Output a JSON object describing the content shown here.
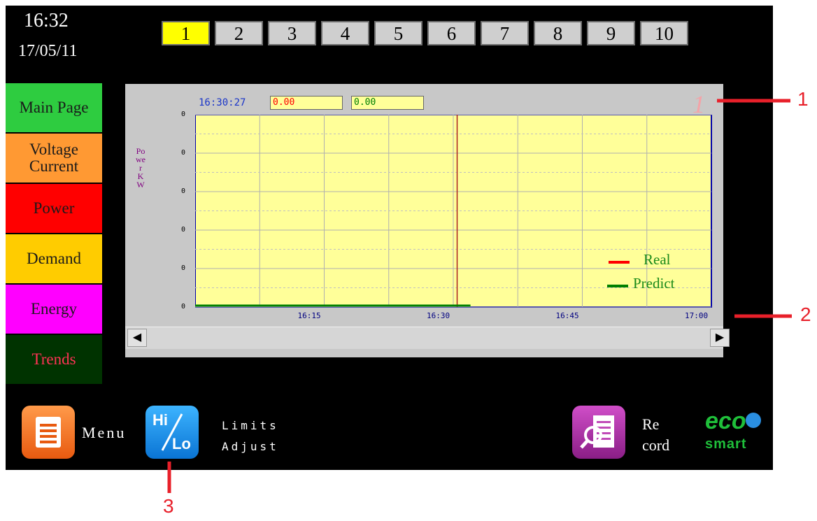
{
  "header": {
    "time": "16:32",
    "date": "17/05/11"
  },
  "tabs": [
    {
      "label": "1",
      "active": true
    },
    {
      "label": "2"
    },
    {
      "label": "3"
    },
    {
      "label": "4"
    },
    {
      "label": "5"
    },
    {
      "label": "6"
    },
    {
      "label": "7"
    },
    {
      "label": "8"
    },
    {
      "label": "9"
    },
    {
      "label": "10"
    }
  ],
  "nav": [
    {
      "label": "Main Page",
      "bg": "#2ecc40",
      "fg": "#1a1a1a"
    },
    {
      "label": "Voltage Current",
      "bg": "#ff9933",
      "fg": "#1a1a1a"
    },
    {
      "label": "Power",
      "bg": "#ff0000",
      "fg": "#1a1a1a"
    },
    {
      "label": "Demand",
      "bg": "#ffcc00",
      "fg": "#1a1a1a"
    },
    {
      "label": "Energy",
      "bg": "#ff00ff",
      "fg": "#1a1a1a"
    },
    {
      "label": "Trends",
      "bg": "#003300",
      "fg": "#ff3355"
    }
  ],
  "trend": {
    "cursor_time": "16:30:27",
    "real_value": "0.00",
    "predict_value": "0.00",
    "y_axis_label": "Power KW",
    "cursor_marker": "1"
  },
  "chart_data": {
    "type": "line",
    "y_tick_labels": [
      "0",
      "0",
      "0",
      "0",
      "0",
      "0"
    ],
    "x_tick_labels": [
      "16:15",
      "16:30",
      "16:45",
      "17:00"
    ],
    "x_range": [
      "16:00",
      "17:00"
    ],
    "cursor_x": "16:30:27",
    "grid": true,
    "legend_position": "bottom-right",
    "series": [
      {
        "name": "Real",
        "color": "#ff0000",
        "x": [
          "16:00",
          "16:30:27"
        ],
        "values": [
          0,
          0
        ]
      },
      {
        "name": "Predict",
        "color": "#008000",
        "x": [
          "16:00",
          "16:32"
        ],
        "values": [
          0,
          0
        ]
      }
    ]
  },
  "bottom": {
    "menu_label": "Menu",
    "hilo_top": "Hi",
    "hilo_bottom": "Lo",
    "limits_line1": "Limits",
    "limits_line2": "Adjust",
    "record_line1": "Re",
    "record_line2": "cord",
    "logo_top": "eco",
    "logo_bottom": "smart"
  },
  "callouts": [
    "1",
    "2",
    "3"
  ],
  "colors": {
    "callout": "#e8202a",
    "accent_tab": "#ffff00",
    "plot_bg": "#ffff99"
  }
}
